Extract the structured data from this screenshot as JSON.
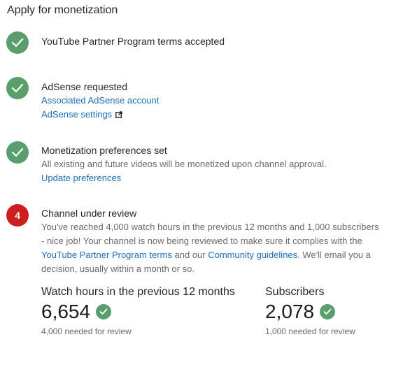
{
  "page": {
    "title": "Apply for monetization"
  },
  "steps": [
    {
      "status": "done",
      "icon": "check-icon",
      "title": "YouTube Partner Program terms accepted"
    },
    {
      "status": "done",
      "icon": "check-icon",
      "title": "AdSense requested",
      "links": [
        "Associated AdSense account",
        "AdSense settings"
      ]
    },
    {
      "status": "done",
      "icon": "check-icon",
      "title": "Monetization preferences set",
      "desc": "All existing and future videos will be monetized upon channel approval.",
      "links": [
        "Update preferences"
      ]
    },
    {
      "status": "pending",
      "number": "4",
      "title": "Channel under review",
      "desc_part1": "You've reached 4,000 watch hours in the previous 12 months and 1,000 subscribers - nice job! Your channel is now being reviewed to make sure it complies with the ",
      "desc_link1": "YouTube Partner Program terms",
      "desc_part2": " and our ",
      "desc_link2": "Community guidelines",
      "desc_part3": ". We'll email you a decision, usually within a month or so."
    }
  ],
  "stats": {
    "watch_hours": {
      "label": "Watch hours in the previous 12 months",
      "value": "6,654",
      "hint": "4,000 needed for review"
    },
    "subscribers": {
      "label": "Subscribers",
      "value": "2,078",
      "hint": "1,000 needed for review"
    }
  },
  "colors": {
    "success": "#5a9e6b",
    "pending": "#cc1f1f",
    "link": "#1c6fb8",
    "text": "#282828",
    "muted": "#6b6b6b"
  }
}
